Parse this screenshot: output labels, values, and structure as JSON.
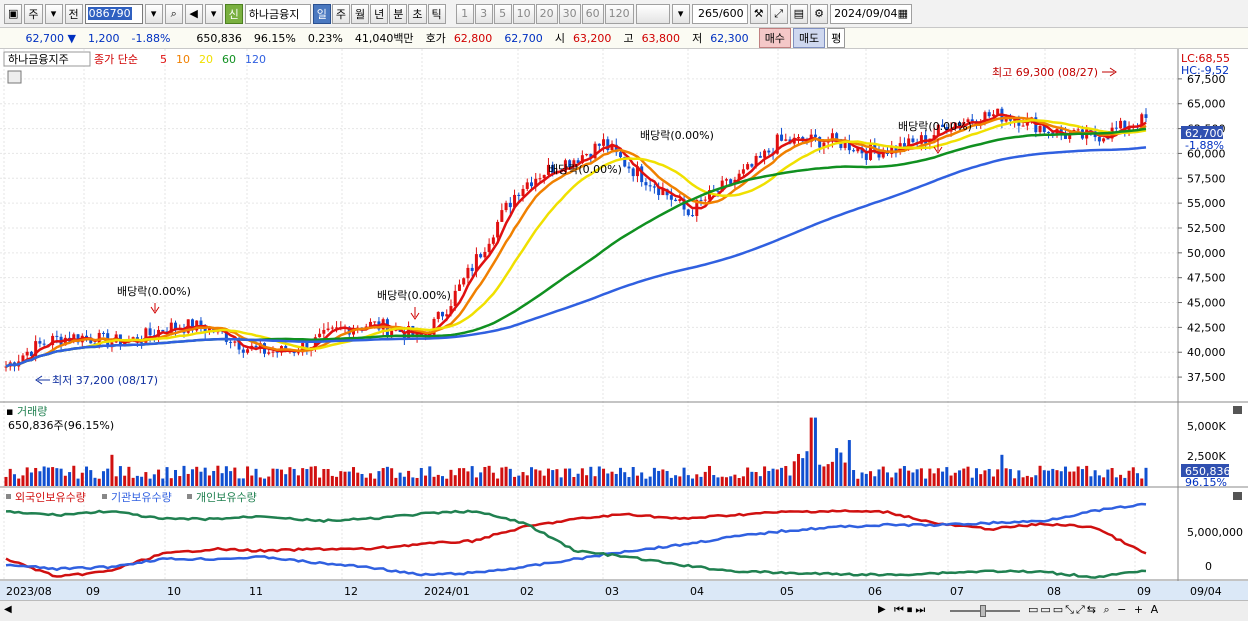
{
  "toolbar": {
    "type_label": "주",
    "prefix_label": "전",
    "code": "086790",
    "stock_name": "하나금융지",
    "shin_label": "신",
    "periods": [
      "일",
      "주",
      "월",
      "년",
      "분",
      "초",
      "틱"
    ],
    "active_period": "일",
    "intervals": [
      "1",
      "3",
      "5",
      "10",
      "20",
      "30",
      "60",
      "120"
    ],
    "count": "265",
    "count_total": "/600",
    "date": "2024/09/04"
  },
  "info": {
    "price": "62,700",
    "direction": "▼",
    "change": "1,200",
    "change_pct": "-1.88%",
    "volume": "650,836",
    "volume_ratio": "96.15%",
    "turnover": "0.23%",
    "amount": "41,040백만",
    "quote_label": "호가",
    "ask": "62,800",
    "bid": "62,700",
    "open_label": "시",
    "open": "63,200",
    "high_label": "고",
    "high": "63,800",
    "low_label": "저",
    "low": "62,300",
    "buy_label": "매수",
    "sell_label": "매도",
    "avg_label": "평"
  },
  "price_panel": {
    "stock_label": "하나금융지주",
    "series_label": "종가 단순",
    "ma_labels": [
      "5",
      "10",
      "20",
      "60",
      "120"
    ],
    "ma_colors": [
      "#e01010",
      "#f08000",
      "#f0e000",
      "#109020",
      "#3060e0"
    ],
    "lc": "LC:68,55",
    "hc": "HC:-9,52",
    "current_price": "62,700",
    "current_pct": "-1.88%",
    "y_ticks": [
      "67,500",
      "65,000",
      "62,500",
      "60,000",
      "57,500",
      "55,000",
      "52,500",
      "50,000",
      "47,500",
      "45,000",
      "42,500",
      "40,000",
      "37,500"
    ],
    "y_values": [
      67500,
      65000,
      62500,
      60000,
      57500,
      55000,
      52500,
      50000,
      47500,
      45000,
      42500,
      40000,
      37500
    ],
    "annotations": {
      "div1": "배당락(0.00%)",
      "div2": "배당락(0.00%)",
      "div3": "배당락(0.00%)",
      "div4": "배당락(0.00%)",
      "div5": "배당락(0.00%)",
      "low": "최저 37,200 (08/17)",
      "high": "최고 69,300 (08/27)"
    }
  },
  "volume_panel": {
    "label": "거래량",
    "value_label": "650,836주(96.15%)",
    "y_ticks": [
      "5,000K",
      "2,500K"
    ],
    "current": "650,836",
    "current_pct": "96.15%"
  },
  "holdings_panel": {
    "labels": [
      "외국인보유수량",
      "기관보유수량",
      "개인보유수량"
    ],
    "colors": [
      "#d01010",
      "#3060e0",
      "#208050"
    ],
    "y_ticks": [
      "5,000,000",
      "0"
    ]
  },
  "x_axis": {
    "labels": [
      "2023/08",
      "09",
      "10",
      "11",
      "12",
      "2024/01",
      "02",
      "03",
      "04",
      "05",
      "06",
      "07",
      "08",
      "09"
    ],
    "right_label": "09/04"
  },
  "chart_data": {
    "type": "candlestick",
    "title": "하나금융지주",
    "ylim": [
      36000,
      69500
    ],
    "monthly_close": [
      {
        "month": "2023/08",
        "close": 38500
      },
      {
        "month": "09",
        "close": 41500
      },
      {
        "month": "10",
        "close": 42500
      },
      {
        "month": "11",
        "close": 40500
      },
      {
        "month": "12",
        "close": 41800
      },
      {
        "month": "2024/01",
        "close": 42000
      },
      {
        "month": "02",
        "close": 55500
      },
      {
        "month": "03",
        "close": 62000
      },
      {
        "month": "04",
        "close": 53000
      },
      {
        "month": "05",
        "close": 62000
      },
      {
        "month": "06",
        "close": 59500
      },
      {
        "month": "07",
        "close": 63500
      },
      {
        "month": "08",
        "close": 62500
      },
      {
        "month": "09",
        "close": 62700
      }
    ],
    "low_point": {
      "value": 37200,
      "date": "08/17"
    },
    "high_point": {
      "value": 69300,
      "date": "08/27"
    }
  }
}
